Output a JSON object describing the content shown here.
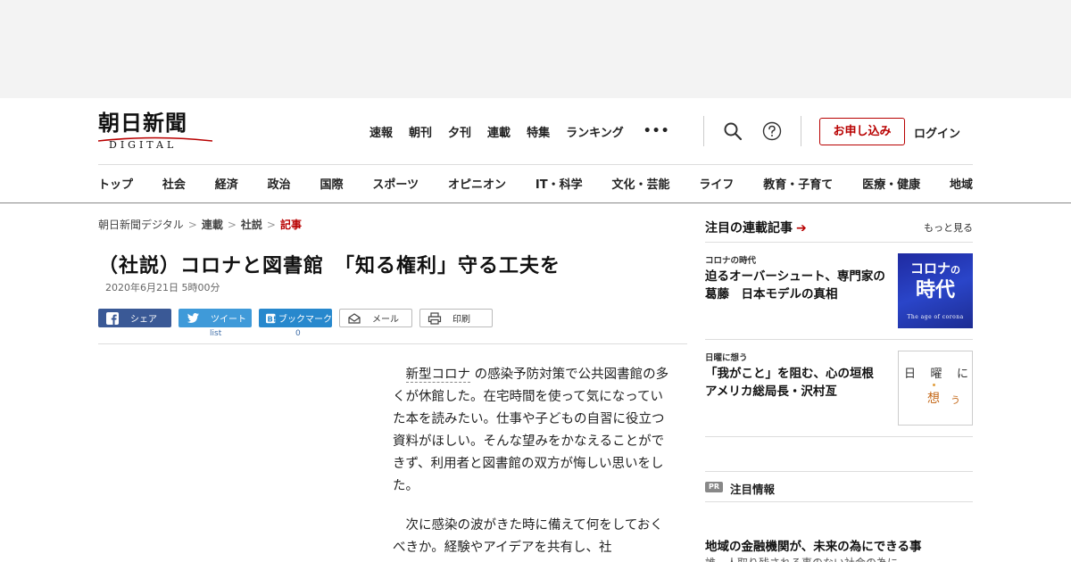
{
  "header": {
    "logo_kanji": "朝日新聞",
    "logo_sub": "DIGITAL",
    "nav": [
      "速報",
      "朝刊",
      "夕刊",
      "連載",
      "特集",
      "ランキング"
    ],
    "more": "•••",
    "subscribe_label": "お申し込み",
    "login_label": "ログイン"
  },
  "categories": [
    "トップ",
    "社会",
    "経済",
    "政治",
    "国際",
    "スポーツ",
    "オピニオン",
    "IT・科学",
    "文化・芸能",
    "ライフ",
    "教育・子育て",
    "医療・健康",
    "地域"
  ],
  "breadcrumb": {
    "items": [
      "朝日新聞デジタル",
      "連載",
      "社説"
    ],
    "current": "記事",
    "separator": ">"
  },
  "article": {
    "title": "（社説）コロナと図書館　「知る権利」守る工夫を",
    "date": "2020年6月21日 5時00分",
    "share": {
      "facebook": "シェア",
      "twitter": "ツイート",
      "twitter_count": "list",
      "hatena": "ブックマーク",
      "hatena_count": "0",
      "mail": "メール",
      "print": "印刷"
    },
    "para1_keyword": "新型コロナ",
    "para1_rest": "の感染予防対策で公共図書館の多くが休館した。在宅時間を使って気になっていた本を読みたい。仕事や子どもの自習に役立つ資料がほしい。そんな望みをかなえることができず、利用者と図書館の双方が悔しい思いをした。",
    "para2": "次に感染の波がきた時に備えて何をしておくべきか。経験やアイデアを共有し、社"
  },
  "sidebar": {
    "heading": "注目の連載記事",
    "arrow": "➔",
    "more": "もっと見る",
    "items": [
      {
        "category": "コロナの時代",
        "title": "迫るオーバーシュート、専門家の葛藤　日本モデルの真相",
        "thumb_line1": "コロナ",
        "thumb_line1b": "の",
        "thumb_line2": "時代",
        "thumb_line3": "The age of corona"
      },
      {
        "category": "日曜に想う",
        "title": "「我がこと」を阻む、心の垣根　アメリカ総局長・沢村亙",
        "thumb_chars": [
          "日",
          "曜",
          "に"
        ],
        "thumb_accent": "想",
        "thumb_accent2": "う"
      }
    ],
    "pr_badge": "PR",
    "pr_label": "注目情報",
    "pr_title": "地域の金融機関が、未来の為にできる事",
    "pr_sub": "誰一人取り残される事のない社会の為に"
  }
}
